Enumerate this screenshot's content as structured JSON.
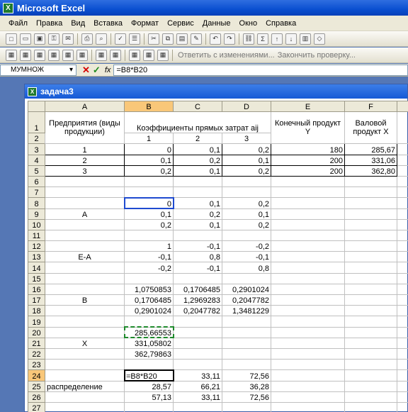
{
  "app": {
    "title": "Microsoft Excel",
    "icon": "excel-icon"
  },
  "menu": [
    "Файл",
    "Правка",
    "Вид",
    "Вставка",
    "Формат",
    "Сервис",
    "Данные",
    "Окно",
    "Справка"
  ],
  "toolbar2": {
    "reply_text": "Ответить с изменениями...",
    "end_review_text": "Закончить проверку..."
  },
  "formula_bar": {
    "name_box": "МУМНОЖ",
    "formula": "=B8*B20"
  },
  "workbook": {
    "title": "задача3"
  },
  "columns": [
    "A",
    "B",
    "C",
    "D",
    "E",
    "F"
  ],
  "rows": [
    [
      "Предприятия (виды продукции)",
      "Коэффициенты прямых затрат aij",
      "",
      "",
      "Конечный продукт Y",
      "Валовой продукт X"
    ],
    [
      "",
      "1",
      "2",
      "3",
      "",
      ""
    ],
    [
      "1",
      "0",
      "0,1",
      "0,2",
      "180",
      "285,67"
    ],
    [
      "2",
      "0,1",
      "0,2",
      "0,1",
      "200",
      "331,06"
    ],
    [
      "3",
      "0,2",
      "0,1",
      "0,2",
      "200",
      "362,80"
    ],
    [
      "",
      "",
      "",
      "",
      "",
      ""
    ],
    [
      "",
      "",
      "",
      "",
      "",
      ""
    ],
    [
      "",
      "0",
      "0,1",
      "0,2",
      "",
      ""
    ],
    [
      "A",
      "0,1",
      "0,2",
      "0,1",
      "",
      ""
    ],
    [
      "",
      "0,2",
      "0,1",
      "0,2",
      "",
      ""
    ],
    [
      "",
      "",
      "",
      "",
      "",
      ""
    ],
    [
      "",
      "1",
      "-0,1",
      "-0,2",
      "",
      ""
    ],
    [
      "E-A",
      "-0,1",
      "0,8",
      "-0,1",
      "",
      ""
    ],
    [
      "",
      "-0,2",
      "-0,1",
      "0,8",
      "",
      ""
    ],
    [
      "",
      "",
      "",
      "",
      "",
      ""
    ],
    [
      "",
      "1,0750853",
      "0,1706485",
      "0,2901024",
      "",
      ""
    ],
    [
      "B",
      "0,1706485",
      "1,2969283",
      "0,2047782",
      "",
      ""
    ],
    [
      "",
      "0,2901024",
      "0,2047782",
      "1,3481229",
      "",
      ""
    ],
    [
      "",
      "",
      "",
      "",
      "",
      ""
    ],
    [
      "",
      "285,66553",
      "",
      "",
      "",
      ""
    ],
    [
      "X",
      "331,05802",
      "",
      "",
      "",
      ""
    ],
    [
      "",
      "362,79863",
      "",
      "",
      "",
      ""
    ],
    [
      "",
      "",
      "",
      "",
      "",
      ""
    ],
    [
      "",
      "=B8*B20",
      "33,11",
      "72,56",
      "",
      ""
    ],
    [
      "распределение",
      "28,57",
      "66,21",
      "36,28",
      "",
      ""
    ],
    [
      "",
      "57,13",
      "33,11",
      "72,56",
      "",
      ""
    ],
    [
      "",
      "",
      "",
      "",
      "",
      ""
    ]
  ]
}
